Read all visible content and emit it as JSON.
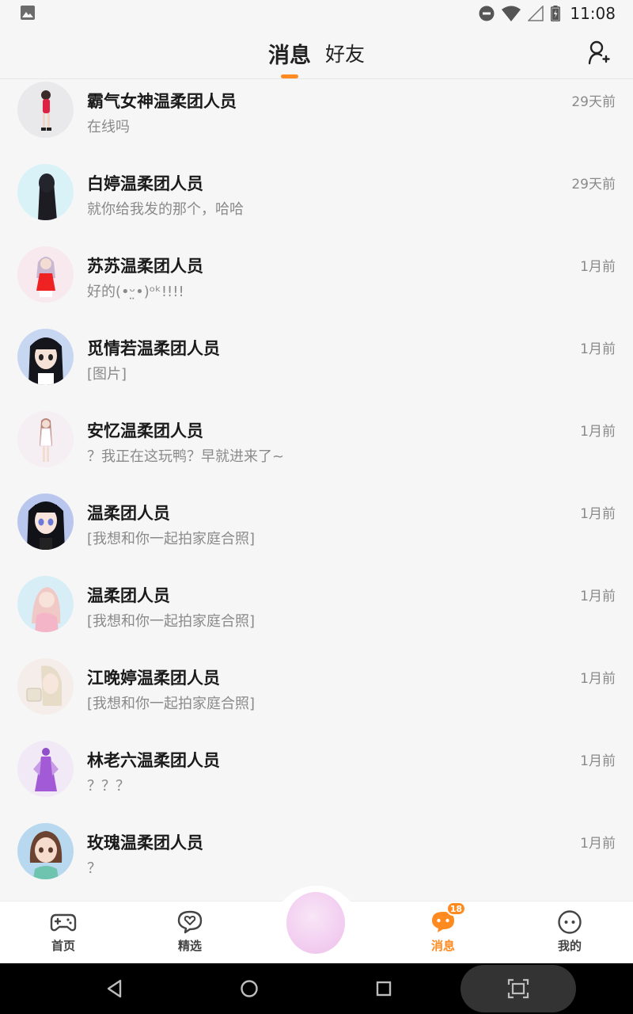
{
  "status_bar": {
    "time": "11:08",
    "icons": [
      "image-icon",
      "dnd-icon",
      "wifi-icon",
      "signal-icon",
      "battery-icon"
    ]
  },
  "header": {
    "tabs": [
      {
        "label": "消息",
        "active": true
      },
      {
        "label": "好友",
        "active": false
      }
    ],
    "add_friend_icon": "add-user-icon"
  },
  "conversations": [
    {
      "name": "霸气女神温柔团人员",
      "preview": "在线吗",
      "time": "29天前",
      "avatar_bg": "#e9e9ec"
    },
    {
      "name": "白婷温柔团人员",
      "preview": "就你给我发的那个，哈哈",
      "time": "29天前",
      "avatar_bg": "#d9f2f8"
    },
    {
      "name": "苏苏温柔团人员",
      "preview": "好的(•ᵕ̤•)ᵒᵏ!!!!",
      "time": "1月前",
      "avatar_bg": "#f7e9ee"
    },
    {
      "name": "觅情若温柔团人员",
      "preview": "[图片]",
      "time": "1月前",
      "avatar_bg": "#c7d7f2"
    },
    {
      "name": "安忆温柔团人员",
      "preview": "？我正在这玩鸭？早就进来了~",
      "time": "1月前",
      "avatar_bg": "#f5eef3"
    },
    {
      "name": "温柔团人员",
      "preview": "[我想和你一起拍家庭合照]",
      "time": "1月前",
      "avatar_bg": "#b9c6ee"
    },
    {
      "name": "温柔团人员",
      "preview": "[我想和你一起拍家庭合照]",
      "time": "1月前",
      "avatar_bg": "#d8eef6"
    },
    {
      "name": "江晚婷温柔团人员",
      "preview": "[我想和你一起拍家庭合照]",
      "time": "1月前",
      "avatar_bg": "#f4ede9"
    },
    {
      "name": "林老六温柔团人员",
      "preview": "？？？",
      "time": "1月前",
      "avatar_bg": "#f1e9f5"
    },
    {
      "name": "玫瑰温柔团人员",
      "preview": "？",
      "time": "1月前",
      "avatar_bg": "#b7d8ef"
    }
  ],
  "bottom_nav": {
    "items": [
      {
        "label": "首页",
        "icon": "gamepad-icon",
        "active": false
      },
      {
        "label": "精选",
        "icon": "heart-bubble-icon",
        "active": false
      },
      {
        "label": "消息",
        "icon": "message-icon",
        "active": true,
        "badge": "18"
      },
      {
        "label": "我的",
        "icon": "face-icon",
        "active": false
      }
    ],
    "center_icon": "center-avatar"
  },
  "colors": {
    "accent": "#ff8a1f",
    "background": "#f6f6f6",
    "text_primary": "#1a1a1a",
    "text_secondary": "#8a8a8a"
  }
}
